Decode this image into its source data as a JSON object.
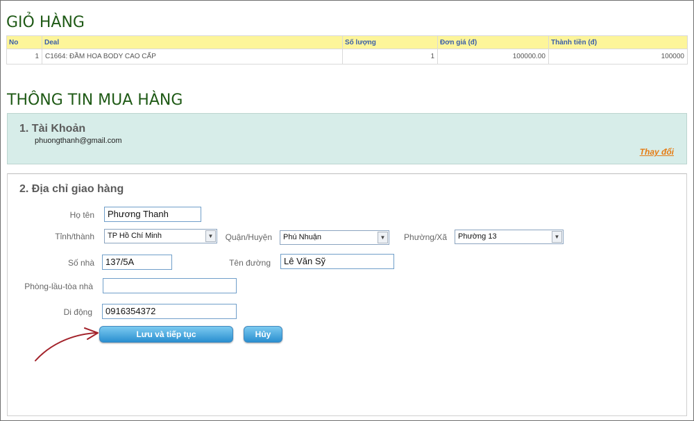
{
  "cart": {
    "title": "GIỎ HÀNG",
    "headers": [
      "No",
      "Deal",
      "Số lượng",
      "Đơn giá (đ)",
      "Thành tiền (đ)"
    ],
    "rows": [
      {
        "no": "1",
        "deal": "C1664: ĐẦM HOA BODY CAO CẤP",
        "quantity": "1",
        "unit_price": "100000.00",
        "total": "100000"
      }
    ]
  },
  "purchase": {
    "title": "THÔNG TIN MUA HÀNG",
    "account": {
      "heading": "1. Tài Khoản",
      "email": "phuongthanh@gmail.com",
      "change_link": "Thay đổi"
    },
    "address": {
      "heading": "2. Địa chỉ giao hàng",
      "name_label": "Họ tên",
      "name_value": "Phương Thanh",
      "province_label": "Tỉnh/thành",
      "province_value": "TP Hồ Chí Minh",
      "district_label": "Quận/Huyện",
      "district_value": "Phú Nhuận",
      "ward_label": "Phường/Xã",
      "ward_value": "Phường 13",
      "house_label": "Số nhà",
      "house_value": "137/5A",
      "street_label": "Tên đường",
      "street_value": "Lê Văn Sỹ",
      "room_label": "Phòng-lầu-tòa nhà",
      "room_value": "",
      "mobile_label": "Di động",
      "mobile_value": "0916354372",
      "save_button": "Lưu và tiếp tục",
      "cancel_button": "Hủy"
    }
  },
  "colors": {
    "heading_green": "#1f5a16",
    "table_header_bg": "#fdf59a",
    "account_panel_bg": "#d7ede9",
    "link_orange": "#e57c14",
    "button_blue": "#2a8fd0",
    "annotation_arrow": "#a3232b"
  }
}
